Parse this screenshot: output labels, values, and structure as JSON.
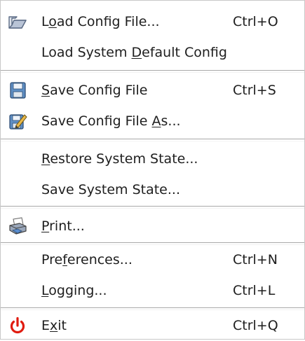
{
  "menu": {
    "items": [
      {
        "id": "load-config-file",
        "label_parts": [
          "L",
          "o",
          "ad Config File..."
        ],
        "shortcut": "Ctrl+O",
        "icon": "folder-open-icon"
      },
      {
        "id": "load-system-default-config",
        "label_parts": [
          "Load System ",
          "D",
          "efault Config"
        ],
        "shortcut": "",
        "icon": ""
      },
      {
        "id": "save-config-file",
        "label_parts": [
          "",
          "S",
          "ave Config File"
        ],
        "shortcut": "Ctrl+S",
        "icon": "floppy-disk-icon"
      },
      {
        "id": "save-config-file-as",
        "label_parts": [
          "Save Config File ",
          "A",
          "s..."
        ],
        "shortcut": "",
        "icon": "save-as-icon"
      },
      {
        "id": "restore-system-state",
        "label_parts": [
          "",
          "R",
          "estore System State..."
        ],
        "shortcut": "",
        "icon": ""
      },
      {
        "id": "save-system-state",
        "label_parts": [
          "Save System State...",
          "",
          ""
        ],
        "shortcut": "",
        "icon": ""
      },
      {
        "id": "print",
        "label_parts": [
          "",
          "P",
          "rint..."
        ],
        "shortcut": "",
        "icon": "printer-icon"
      },
      {
        "id": "preferences",
        "label_parts": [
          "Pre",
          "f",
          "erences..."
        ],
        "shortcut": "Ctrl+N",
        "icon": ""
      },
      {
        "id": "logging",
        "label_parts": [
          "",
          "L",
          "ogging..."
        ],
        "shortcut": "Ctrl+L",
        "icon": ""
      },
      {
        "id": "exit",
        "label_parts": [
          "E",
          "x",
          "it"
        ],
        "shortcut": "Ctrl+Q",
        "icon": "power-icon"
      }
    ]
  },
  "colors": {
    "exit_icon": "#e01b0f",
    "folder": "#7d8ea8",
    "floppy": "#4f7fb5"
  }
}
